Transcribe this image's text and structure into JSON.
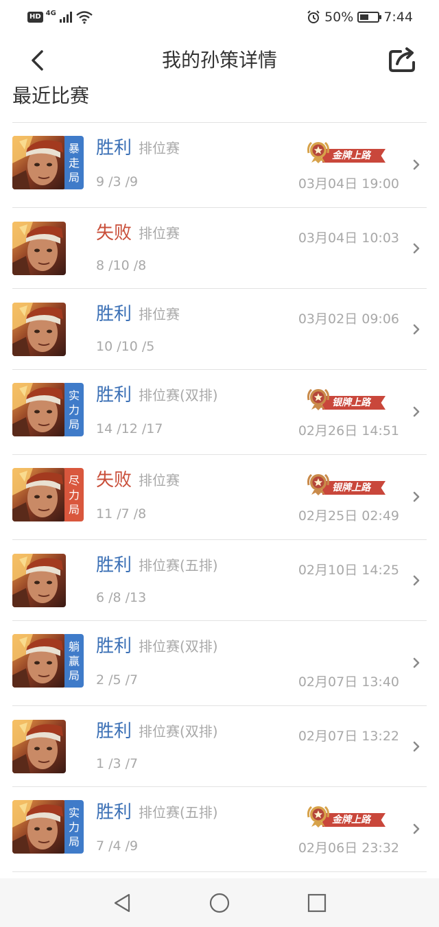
{
  "status_bar": {
    "left_hd": "HD",
    "left_network": "4G",
    "battery_percent": "50%",
    "battery_level": 0.5,
    "time": "7:44"
  },
  "header": {
    "title": "我的孙策详情"
  },
  "section_title": "最近比赛",
  "colors": {
    "win": "#3a6fb5",
    "loss": "#c94f3a",
    "tag_blue": "#3f7bc9",
    "tag_red": "#d9573d",
    "badge_red": "#c9473b"
  },
  "matches": [
    {
      "result": "胜利",
      "outcome": "win",
      "mode": "排位赛",
      "kda": "9 /3 /9",
      "tag": [
        "暴",
        "走",
        "局"
      ],
      "tag_color": "blue",
      "badge": "金牌上路",
      "badge_tier": "gold",
      "date": "03月04日 19:00"
    },
    {
      "result": "失败",
      "outcome": "loss",
      "mode": "排位赛",
      "kda": "8 /10 /8",
      "date": "03月04日 10:03"
    },
    {
      "result": "胜利",
      "outcome": "win",
      "mode": "排位赛",
      "kda": "10 /10 /5",
      "date": "03月02日 09:06"
    },
    {
      "result": "胜利",
      "outcome": "win",
      "mode": "排位赛(双排)",
      "kda": "14 /12 /17",
      "tag": [
        "实",
        "力",
        "局"
      ],
      "tag_color": "blue",
      "badge": "银牌上路",
      "badge_tier": "silver",
      "date": "02月26日 14:51"
    },
    {
      "result": "失败",
      "outcome": "loss",
      "mode": "排位赛",
      "kda": "11 /7 /8",
      "tag": [
        "尽",
        "力",
        "局"
      ],
      "tag_color": "red",
      "badge": "银牌上路",
      "badge_tier": "silver",
      "date": "02月25日 02:49"
    },
    {
      "result": "胜利",
      "outcome": "win",
      "mode": "排位赛(五排)",
      "kda": "6 /8 /13",
      "date": "02月10日 14:25"
    },
    {
      "result": "胜利",
      "outcome": "win",
      "mode": "排位赛(双排)",
      "kda": "2 /5 /7",
      "tag": [
        "躺",
        "赢",
        "局"
      ],
      "tag_color": "blue",
      "date": "02月07日 13:40"
    },
    {
      "result": "胜利",
      "outcome": "win",
      "mode": "排位赛(双排)",
      "kda": "1 /3 /7",
      "date": "02月07日 13:22"
    },
    {
      "result": "胜利",
      "outcome": "win",
      "mode": "排位赛(五排)",
      "kda": "7 /4 /9",
      "tag": [
        "实",
        "力",
        "局"
      ],
      "tag_color": "blue",
      "badge": "金牌上路",
      "badge_tier": "gold",
      "date": "02月06日 23:32"
    }
  ]
}
